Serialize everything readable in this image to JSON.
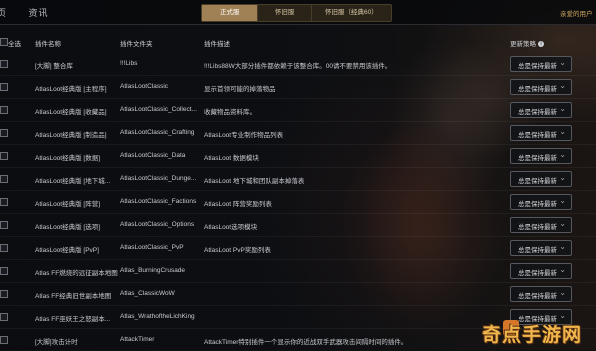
{
  "nav": {
    "items": [
      "页",
      "资讯"
    ]
  },
  "tabs": [
    {
      "label": "正式服",
      "active": true
    },
    {
      "label": "怀旧服",
      "active": false
    },
    {
      "label": "怀旧服（经典60）",
      "active": false
    }
  ],
  "login_text": "亲爱的用户",
  "table": {
    "headers": {
      "select_all": "全选",
      "plugin_name": "插件名称",
      "folder": "插件文件夹",
      "description": "插件描述",
      "update_policy": "更新策略"
    },
    "rows": [
      {
        "name": "[大脚] 整合库",
        "folder": "!!!Libs",
        "description": "!!!Libs88W大部分插件都依赖于该整合库。00请不要禁用该插件。",
        "policy": "总是保持最新"
      },
      {
        "name": "AtlasLoot经典版 [主程序]",
        "folder": "AtlasLootClassic",
        "description": "显示首领可能的掉落物品",
        "policy": "总是保持最新"
      },
      {
        "name": "AtlasLoot经典版 [收藏品]",
        "folder": "AtlasLootClassic_Collect...",
        "description": "收藏物品资料库。",
        "policy": "总是保持最新"
      },
      {
        "name": "AtlasLoot经典版 [制造品]",
        "folder": "AtlasLootClassic_Crafting",
        "description": "AtlasLoot专业制作物品列表",
        "policy": "总是保持最新"
      },
      {
        "name": "AtlasLoot经典版 [数据]",
        "folder": "AtlasLootClassic_Data",
        "description": "AtlasLoot 数据模块",
        "policy": "总是保持最新"
      },
      {
        "name": "AtlasLoot经典版 [地下城...",
        "folder": "AtlasLootClassic_Dunge...",
        "description": "AtlasLoot 地下城和团队副本掉落表",
        "policy": "总是保持最新"
      },
      {
        "name": "AtlasLoot经典版 [阵营]",
        "folder": "AtlasLootClassic_Factions",
        "description": "AtlasLoot 阵营奖励列表",
        "policy": "总是保持最新"
      },
      {
        "name": "AtlasLoot经典版 [选项]",
        "folder": "AtlasLootClassic_Options",
        "description": "AtlasLoot选项模块",
        "policy": "总是保持最新"
      },
      {
        "name": "AtlasLoot经典版 [PvP]",
        "folder": "AtlasLootClassic_PvP",
        "description": "AtlasLoot PvP奖励列表",
        "policy": "总是保持最新"
      },
      {
        "name": "Atlas FF燃烧的远征副本地图",
        "folder": "Atlas_BurningCrusade",
        "description": "",
        "policy": "总是保持最新"
      },
      {
        "name": "Atlas FF经典旧世副本地图",
        "folder": "Atlas_ClassicWoW",
        "description": "",
        "policy": "总是保持最新"
      },
      {
        "name": "Atlas FF巫妖王之怒副本...",
        "folder": "Atlas_WrathoftheLichKing",
        "description": "",
        "policy": "总是保持最新"
      },
      {
        "name": "[大脚]攻击计时",
        "folder": "AttackTimer",
        "description": "AttackTimer特别插件一个显示你的近战双手武器攻击间隔时间的插件。",
        "policy": "总是保持最新"
      }
    ]
  },
  "watermark": "奇点手游网",
  "icons": {
    "info": "info-icon",
    "dropdown": "chevron-down-icon",
    "watermark_logo": "watermark-logo-icon"
  },
  "colors": {
    "accent": "#a08055",
    "login": "#d2a85e",
    "watermark": "#f0b64c"
  }
}
